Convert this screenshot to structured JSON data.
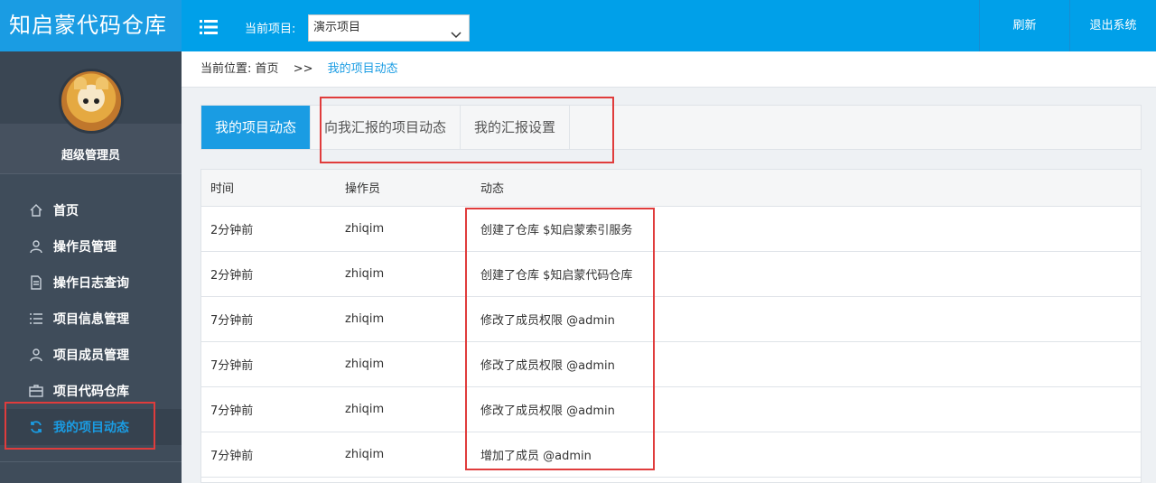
{
  "app": {
    "brand": "知启蒙代码仓库"
  },
  "sidebar": {
    "user": {
      "name": "超级管理员"
    },
    "items": [
      {
        "label": "首页",
        "icon": "home-icon",
        "active": false
      },
      {
        "label": "操作员管理",
        "icon": "user-icon",
        "active": false
      },
      {
        "label": "操作日志查询",
        "icon": "document-icon",
        "active": false
      },
      {
        "label": "项目信息管理",
        "icon": "list-icon",
        "active": false
      },
      {
        "label": "项目成员管理",
        "icon": "user-icon",
        "active": false
      },
      {
        "label": "项目代码仓库",
        "icon": "briefcase-icon",
        "active": false
      },
      {
        "label": "我的项目动态",
        "icon": "refresh-icon",
        "active": true
      }
    ]
  },
  "topbar": {
    "project_label": "当前项目:",
    "project_selected": "演示项目",
    "refresh_label": "刷新",
    "logout_label": "退出系统"
  },
  "breadcrumb": {
    "prefix": "当前位置:",
    "home": "首页",
    "separator": ">>",
    "current": "我的项目动态"
  },
  "tabs": [
    {
      "label": "我的项目动态",
      "active": true
    },
    {
      "label": "向我汇报的项目动态",
      "active": false
    },
    {
      "label": "我的汇报设置",
      "active": false
    }
  ],
  "table": {
    "headers": [
      "时间",
      "操作员",
      "动态"
    ],
    "rows": [
      [
        "2分钟前",
        "zhiqim",
        "创建了仓库 $知启蒙索引服务"
      ],
      [
        "2分钟前",
        "zhiqim",
        "创建了仓库 $知启蒙代码仓库"
      ],
      [
        "7分钟前",
        "zhiqim",
        "修改了成员权限 @admin"
      ],
      [
        "7分钟前",
        "zhiqim",
        "修改了成员权限 @admin"
      ],
      [
        "7分钟前",
        "zhiqim",
        "修改了成员权限 @admin"
      ],
      [
        "7分钟前",
        "zhiqim",
        "增加了成员 @admin"
      ]
    ]
  },
  "colors": {
    "brand": "#1a9ce3",
    "topbar": "#00a0e9",
    "sidebar": "#3f4c5a",
    "highlight": "#e03c3c"
  }
}
